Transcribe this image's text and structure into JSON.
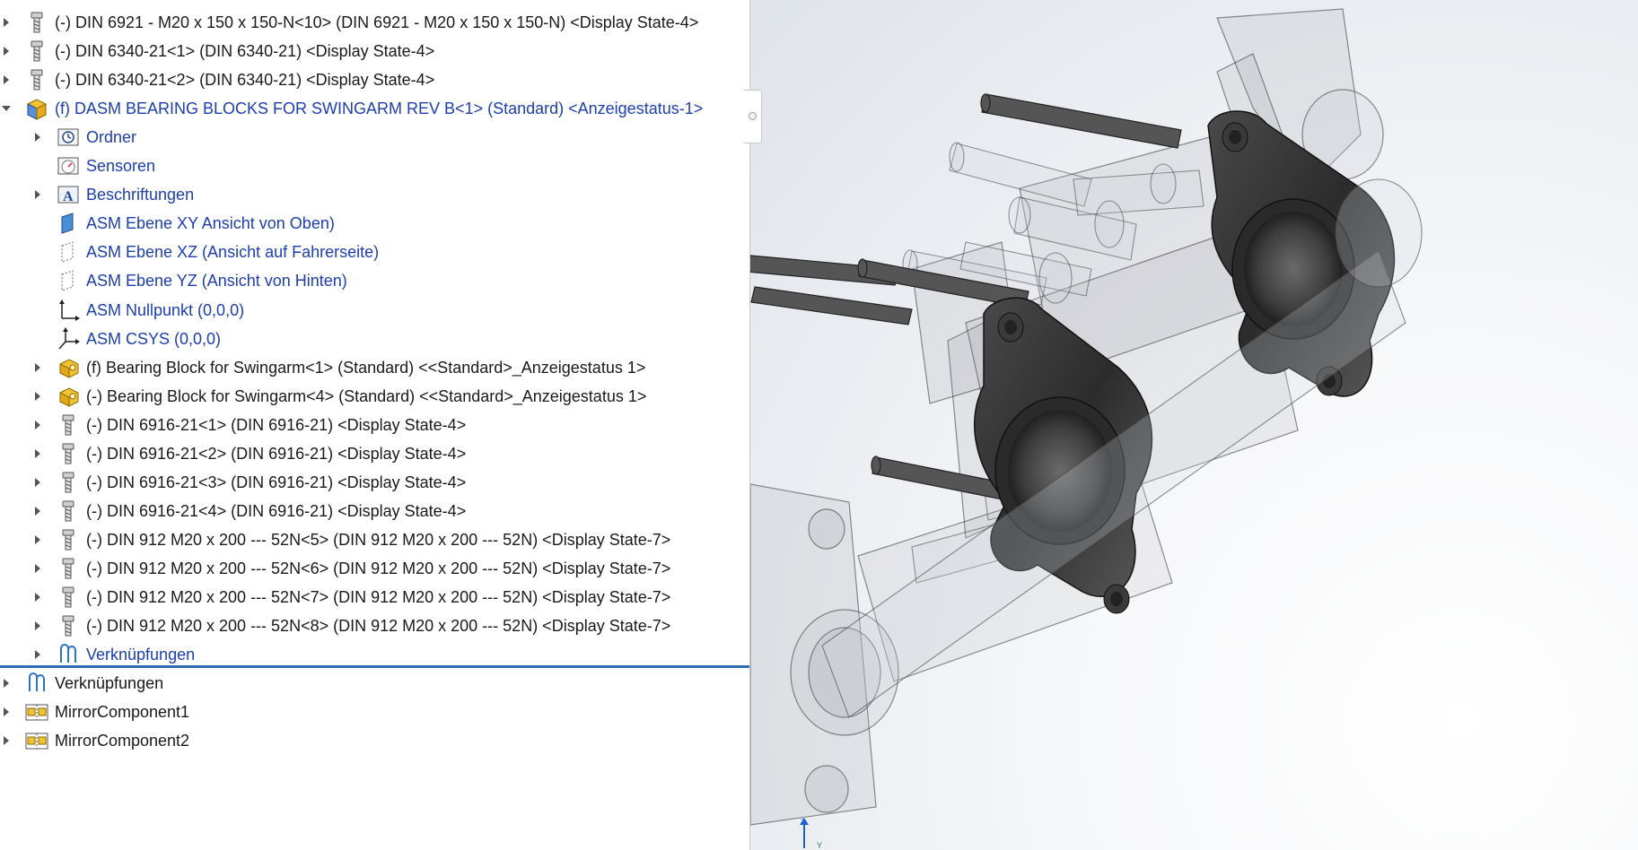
{
  "tree": {
    "rows": [
      {
        "level": 0,
        "expander": "collapsed",
        "icon": "screw-icon",
        "label": "(-) DIN 6921 - M20 x 150 x 150-N<10> (DIN 6921 - M20 x 150 x 150-N) <Display State-4>",
        "blue": false
      },
      {
        "level": 0,
        "expander": "collapsed",
        "icon": "screw-icon",
        "label": "(-) DIN 6340-21<1> (DIN 6340-21) <Display State-4>",
        "blue": false
      },
      {
        "level": 0,
        "expander": "collapsed",
        "icon": "screw-icon",
        "label": "(-) DIN 6340-21<2> (DIN 6340-21) <Display State-4>",
        "blue": false
      },
      {
        "level": 0,
        "expander": "expanded",
        "icon": "assembly-icon",
        "label": "(f) DASM BEARING BLOCKS FOR SWINGARM REV B<1> (Standard) <Anzeigestatus-1>",
        "blue": true
      },
      {
        "level": 1,
        "expander": "collapsed",
        "icon": "history-folder-icon",
        "label": "Ordner",
        "blue": true
      },
      {
        "level": 1,
        "expander": "none",
        "icon": "sensor-icon",
        "label": "Sensoren",
        "blue": true
      },
      {
        "level": 1,
        "expander": "collapsed",
        "icon": "annotation-icon",
        "label": "Beschriftungen",
        "blue": true
      },
      {
        "level": 1,
        "expander": "none",
        "icon": "plane-solid-icon",
        "label": "ASM Ebene XY Ansicht von Oben)",
        "blue": true
      },
      {
        "level": 1,
        "expander": "none",
        "icon": "plane-dashed-icon",
        "label": "ASM Ebene XZ (Ansicht auf Fahrerseite)",
        "blue": true
      },
      {
        "level": 1,
        "expander": "none",
        "icon": "plane-dashed-icon",
        "label": "ASM Ebene YZ (Ansicht von Hinten)",
        "blue": true
      },
      {
        "level": 1,
        "expander": "none",
        "icon": "origin-icon",
        "label": "ASM Nullpunkt (0,0,0)",
        "blue": true
      },
      {
        "level": 1,
        "expander": "none",
        "icon": "csys-icon",
        "label": "ASM CSYS (0,0,0)",
        "blue": true
      },
      {
        "level": 1,
        "expander": "collapsed",
        "icon": "part-icon",
        "label": "(f) Bearing Block for Swingarm<1> (Standard) <<Standard>_Anzeigestatus 1>",
        "blue": false
      },
      {
        "level": 1,
        "expander": "collapsed",
        "icon": "part-icon",
        "label": "(-) Bearing Block for Swingarm<4> (Standard) <<Standard>_Anzeigestatus 1>",
        "blue": false
      },
      {
        "level": 1,
        "expander": "collapsed",
        "icon": "screw-icon",
        "label": "(-) DIN 6916-21<1> (DIN 6916-21) <Display State-4>",
        "blue": false
      },
      {
        "level": 1,
        "expander": "collapsed",
        "icon": "screw-icon",
        "label": "(-) DIN 6916-21<2> (DIN 6916-21) <Display State-4>",
        "blue": false
      },
      {
        "level": 1,
        "expander": "collapsed",
        "icon": "screw-icon",
        "label": "(-) DIN 6916-21<3> (DIN 6916-21) <Display State-4>",
        "blue": false
      },
      {
        "level": 1,
        "expander": "collapsed",
        "icon": "screw-icon",
        "label": "(-) DIN 6916-21<4> (DIN 6916-21) <Display State-4>",
        "blue": false
      },
      {
        "level": 1,
        "expander": "collapsed",
        "icon": "screw-icon",
        "label": "(-) DIN 912 M20 x 200 --- 52N<5> (DIN 912 M20 x 200 --- 52N) <Display State-7>",
        "blue": false
      },
      {
        "level": 1,
        "expander": "collapsed",
        "icon": "screw-icon",
        "label": "(-) DIN 912 M20 x 200 --- 52N<6> (DIN 912 M20 x 200 --- 52N) <Display State-7>",
        "blue": false
      },
      {
        "level": 1,
        "expander": "collapsed",
        "icon": "screw-icon",
        "label": "(-) DIN 912 M20 x 200 --- 52N<7> (DIN 912 M20 x 200 --- 52N) <Display State-7>",
        "blue": false
      },
      {
        "level": 1,
        "expander": "collapsed",
        "icon": "screw-icon",
        "label": "(-) DIN 912 M20 x 200 --- 52N<8> (DIN 912 M20 x 200 --- 52N) <Display State-7>",
        "blue": false
      },
      {
        "level": 1,
        "expander": "collapsed",
        "icon": "mates-icon",
        "label": "Verknüpfungen",
        "blue": true
      },
      {
        "level": 0,
        "expander": "collapsed",
        "icon": "mates-icon",
        "label": "Verknüpfungen",
        "blue": false
      },
      {
        "level": 0,
        "expander": "collapsed",
        "icon": "mirror-component-icon",
        "label": "MirrorComponent1",
        "blue": false
      },
      {
        "level": 0,
        "expander": "collapsed",
        "icon": "mirror-component-icon",
        "label": "MirrorComponent2",
        "blue": false
      }
    ]
  },
  "viewport": {
    "triad_axis_z": "Z",
    "triad_axis_y": "Y"
  }
}
